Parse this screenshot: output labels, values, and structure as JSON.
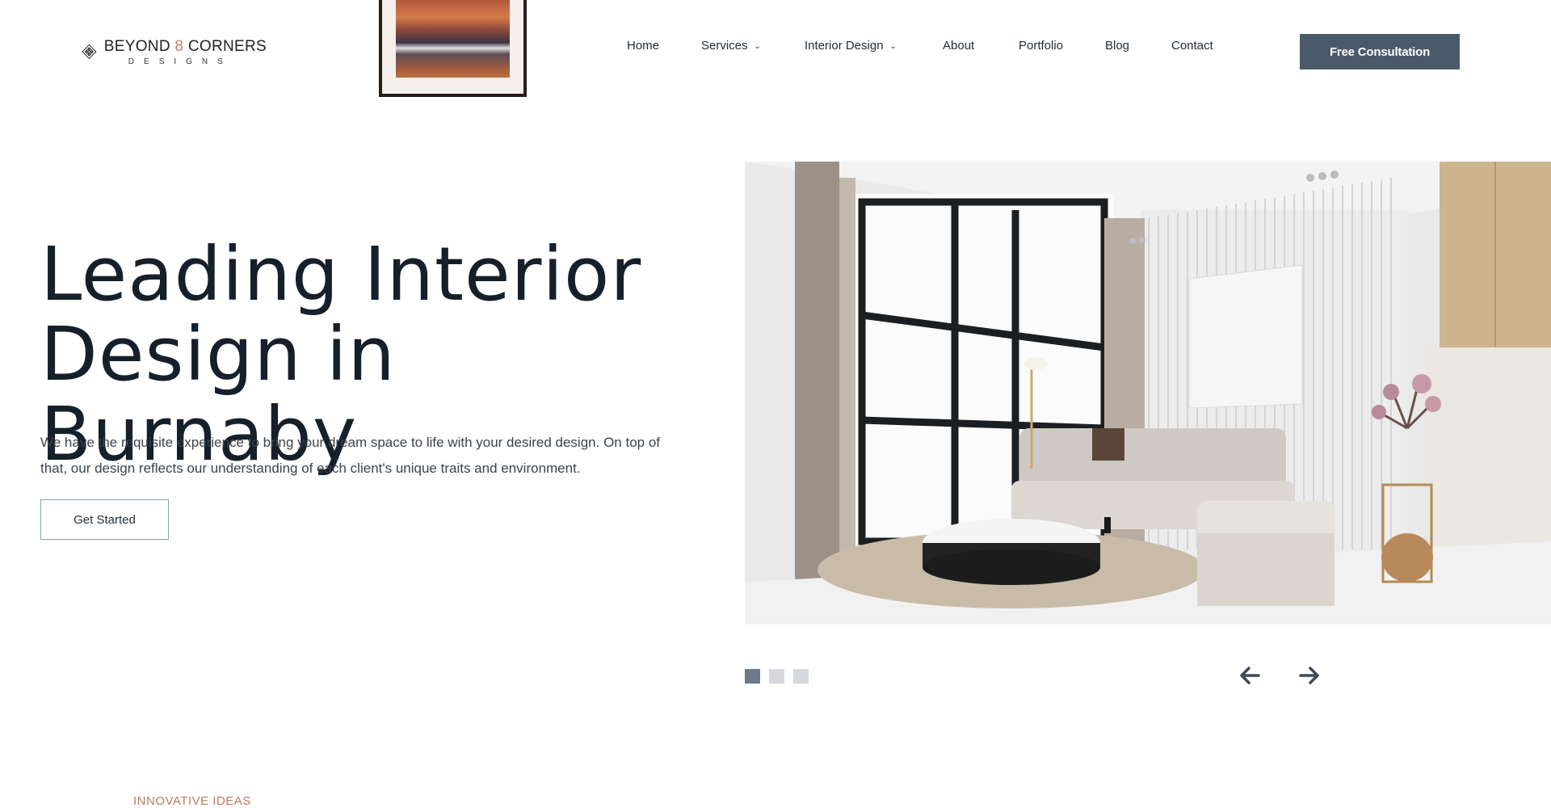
{
  "brand": {
    "name_part1": "BEYOND ",
    "name_accent": "8",
    "name_part2": " CORNERS",
    "tagline": "DESIGNS",
    "accent_color": "#c08466"
  },
  "nav": {
    "items": [
      {
        "label": "Home",
        "has_dropdown": false
      },
      {
        "label": "Services",
        "has_dropdown": true
      },
      {
        "label": "Interior Design",
        "has_dropdown": true
      },
      {
        "label": "About",
        "has_dropdown": false
      },
      {
        "label": "Portfolio",
        "has_dropdown": false
      },
      {
        "label": "Blog",
        "has_dropdown": false
      },
      {
        "label": "Contact",
        "has_dropdown": false
      }
    ],
    "dropdown_icon": "chevron-down-icon"
  },
  "header": {
    "cta_label": "Free Consultation",
    "cta_color": "#4a5a6a"
  },
  "hero": {
    "title_line1": "Leading Interior",
    "title_line2": "Design in Burnaby",
    "description": "We have the requisite experience to bring your dream space to life with your desired design. On top of that, our design reflects our understanding of each client's unique traits and environment.",
    "button_label": "Get Started"
  },
  "slider": {
    "total_slides": 3,
    "active_slide": 1,
    "prev_icon": "arrow-left-icon",
    "next_icon": "arrow-right-icon",
    "active_color": "#6c7a89",
    "inactive_color": "#d5d9de"
  },
  "section": {
    "eyebrow": "INNOVATIVE IDEAS"
  }
}
